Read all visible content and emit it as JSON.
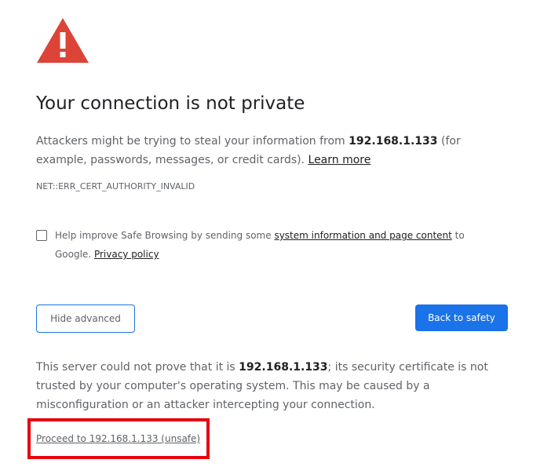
{
  "colors": {
    "warning_red": "#db4437",
    "primary_blue": "#1a73e8",
    "highlight_red": "#e8000f",
    "text_dark": "#202124",
    "text_gray": "#5f6368"
  },
  "icon": {
    "name": "warning-triangle-icon"
  },
  "heading": "Your connection is not private",
  "intro": {
    "before_host": "Attackers might be trying to steal your information from ",
    "host": "192.168.1.133",
    "after_host": " (for example, passwords, messages, or credit cards). ",
    "learn_more": "Learn more"
  },
  "error_code": "NET::ERR_CERT_AUTHORITY_INVALID",
  "safe_browsing": {
    "checked": false,
    "text_before": "Help improve Safe Browsing by sending some ",
    "system_info_link": "system information and page content",
    "text_middle": " to Google. ",
    "privacy_link": "Privacy policy"
  },
  "buttons": {
    "hide_advanced": "Hide advanced",
    "back_to_safety": "Back to safety"
  },
  "details": {
    "before_host": "This server could not prove that it is ",
    "host": "192.168.1.133",
    "after_host": "; its security certificate is not trusted by your computer's operating system. This may be caused by a misconfiguration or an attacker intercepting your connection."
  },
  "proceed_link": "Proceed to 192.168.1.133 (unsafe)"
}
